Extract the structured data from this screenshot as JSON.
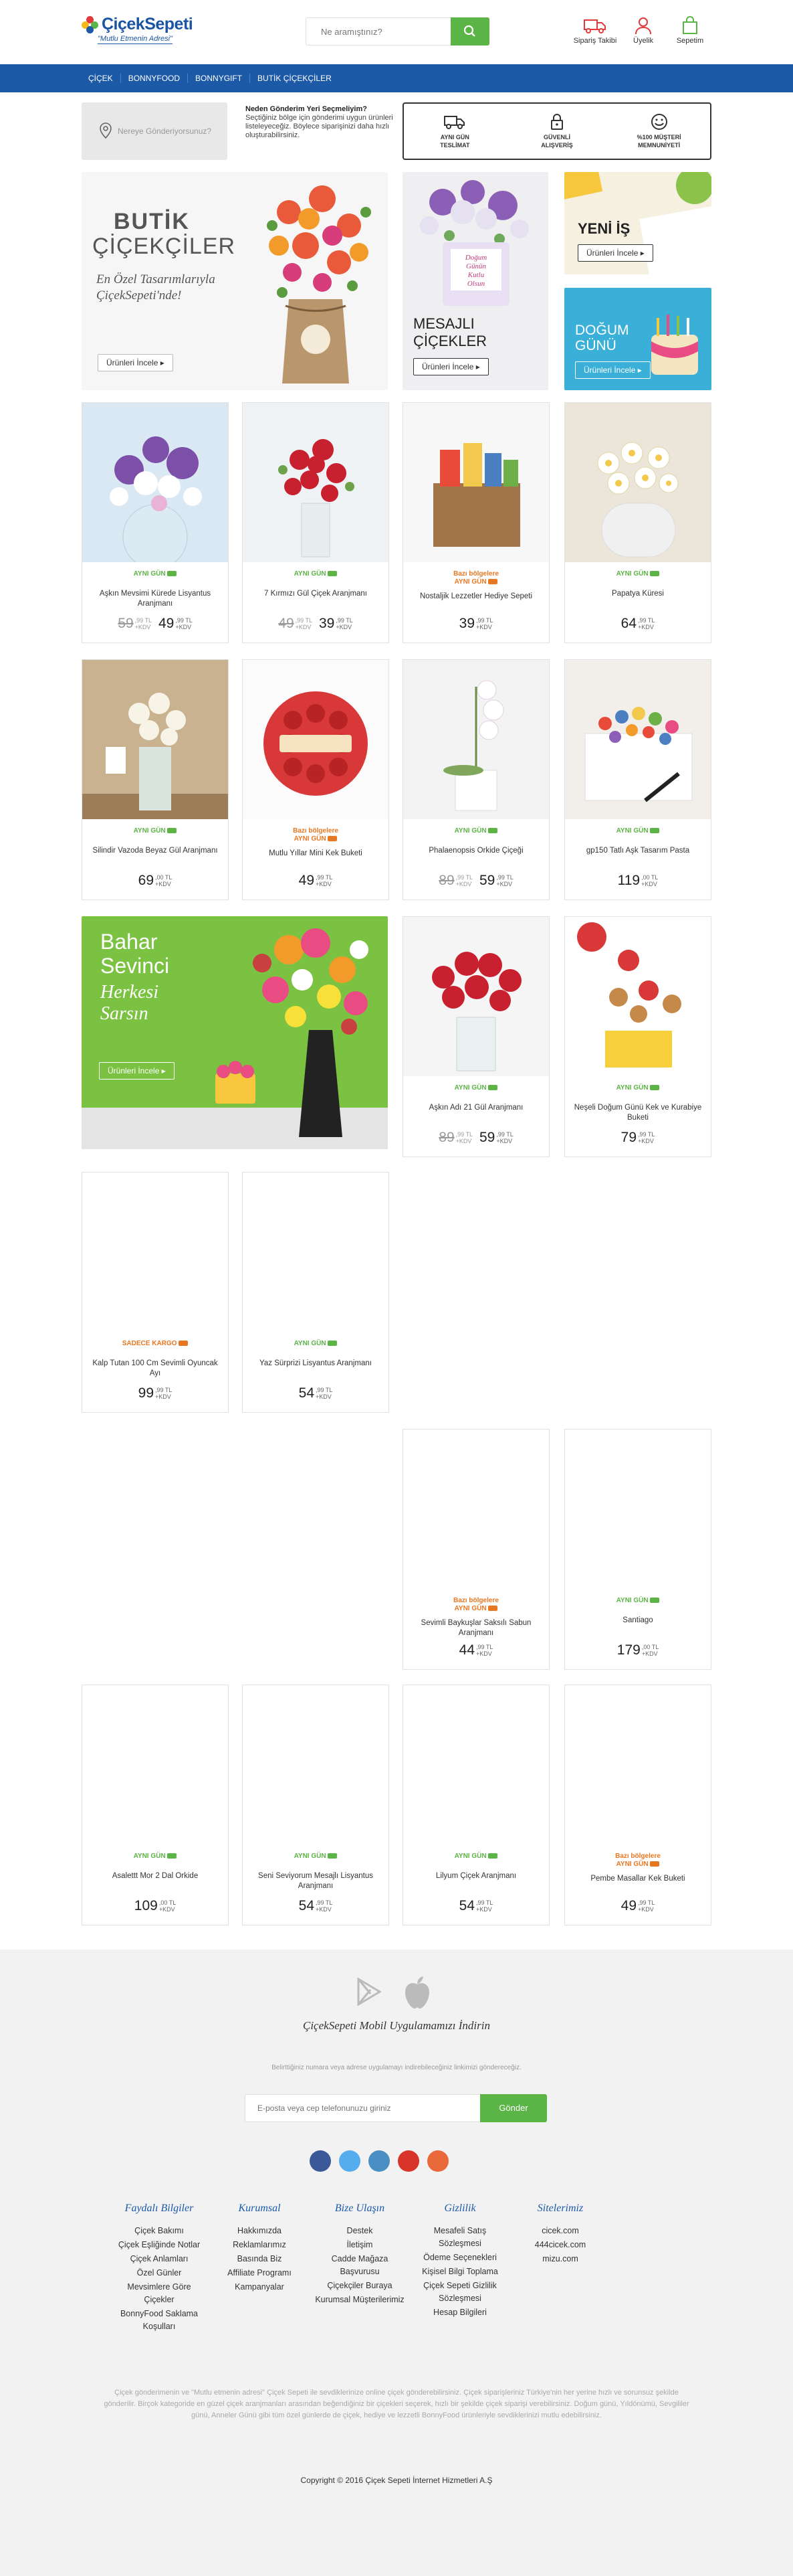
{
  "header": {
    "brand": "ÇiçekSepeti",
    "tagline": "\"Mutlu Etmenin Adresi\"",
    "search_placeholder": "Ne aramıştınız?",
    "actions": [
      {
        "label": "Sipariş Takibi",
        "icon": "truck-icon"
      },
      {
        "label": "Üyelik",
        "icon": "user-icon"
      },
      {
        "label": "Sepetim",
        "icon": "bag-icon"
      }
    ]
  },
  "nav": [
    "ÇİÇEK",
    "BONNYFOOD",
    "BONNYGIFT",
    "BUTİK ÇİÇEKÇİLER"
  ],
  "location": {
    "placeholder": "Nereye Gönderiyorsunuz?"
  },
  "why": {
    "title": "Neden Gönderim Yeri Seçmeliyim?",
    "text": "Seçtiğiniz bölge için gönderimi uygun ürünleri listeleyeceğiz. Böylece siparişinizi daha hızlı oluşturabilirsiniz."
  },
  "features": [
    {
      "icon": "truck-icon",
      "l1": "AYNI GÜN",
      "l2": "TESLİMAT"
    },
    {
      "icon": "lock-icon",
      "l1": "GÜVENLİ",
      "l2": "ALIŞVERİŞ"
    },
    {
      "icon": "smile-icon",
      "l1": "%100 MÜŞTERİ",
      "l2": "MEMNUNİYETİ"
    }
  ],
  "banners": {
    "butik": {
      "title1": "BUTİK",
      "title2": "ÇİÇEKÇİLER",
      "sub1": "En Özel Tasarımlarıyla",
      "sub2": "ÇiçekSepeti'nde!",
      "cta": "Ürünleri İncele"
    },
    "mesajli": {
      "title1": "MESAJLI",
      "title2": "ÇİÇEKLER",
      "cta": "Ürünleri İncele",
      "tag1": "Doğum",
      "tag2": "Günün",
      "tag3": "Kutlu",
      "tag4": "Olsun"
    },
    "yenis": {
      "title": "YENİ İŞ",
      "cta": "Ürünleri İncele"
    },
    "dogum": {
      "title1": "DOĞUM",
      "title2": "GÜNÜ",
      "cta": "Ürünleri İncele"
    },
    "bahar": {
      "title1": "Bahar",
      "title2": "Sevinci",
      "sub1": "Herkesi",
      "sub2": "Sarsın",
      "cta": "Ürünleri İncele"
    }
  },
  "products": [
    {
      "badge": "AYNI GÜN",
      "badge2": "",
      "name": "Aşkın Mevsimi Kürede Lisyantus Aranjmanı",
      "old": "59",
      "oldsm": ",99 TL",
      "price": "49",
      "sm": ",99 TL",
      "kdv": "+KDV"
    },
    {
      "badge": "AYNI GÜN",
      "badge2": "",
      "name": "7 Kırmızı Gül Çiçek Aranjmanı",
      "old": "49",
      "oldsm": ",99 TL",
      "price": "39",
      "sm": ",99 TL",
      "kdv": "+KDV"
    },
    {
      "badge": "Bazı bölgelere",
      "badge2": "AYNI GÜN",
      "name": "Nostaljik Lezzetler Hediye Sepeti",
      "old": "",
      "oldsm": "",
      "price": "39",
      "sm": ",99 TL",
      "kdv": "+KDV"
    },
    {
      "badge": "AYNI GÜN",
      "badge2": "",
      "name": "Papatya Küresi",
      "old": "",
      "oldsm": "",
      "price": "64",
      "sm": ",99 TL",
      "kdv": "+KDV"
    },
    {
      "badge": "AYNI GÜN",
      "badge2": "",
      "name": "Silindir Vazoda Beyaz Gül Aranjmanı",
      "old": "",
      "oldsm": "",
      "price": "69",
      "sm": ",00 TL",
      "kdv": "+KDV"
    },
    {
      "badge": "Bazı bölgelere",
      "badge2": "AYNI GÜN",
      "name": "Mutlu Yıllar Mini Kek Buketi",
      "old": "",
      "oldsm": "",
      "price": "49",
      "sm": ",99 TL",
      "kdv": "+KDV"
    },
    {
      "badge": "AYNI GÜN",
      "badge2": "",
      "name": "Phalaenopsis Orkide Çiçeği",
      "old": "89",
      "oldsm": ",99 TL",
      "price": "59",
      "sm": ",99 TL",
      "kdv": "+KDV"
    },
    {
      "badge": "AYNI GÜN",
      "badge2": "",
      "name": "gp150 Tatlı Aşk Tasarım Pasta",
      "old": "",
      "oldsm": "",
      "price": "119",
      "sm": ",00 TL",
      "kdv": "+KDV"
    },
    {
      "badge": "AYNI GÜN",
      "badge2": "",
      "name": "Aşkın Adı 21 Gül Aranjmanı",
      "old": "89",
      "oldsm": ",99 TL",
      "price": "59",
      "sm": ",99 TL",
      "kdv": "+KDV"
    },
    {
      "badge": "AYNI GÜN",
      "badge2": "",
      "name": "Neşeli Doğum Günü Kek ve Kurabiye Buketi",
      "old": "",
      "oldsm": "",
      "price": "79",
      "sm": ",99 TL",
      "kdv": "+KDV"
    },
    {
      "badge": "SADECE KARGO",
      "badge2": "",
      "name": "Kalp Tutan 100 Cm Sevimli Oyuncak Ayı",
      "old": "",
      "oldsm": "",
      "price": "99",
      "sm": ",99 TL",
      "kdv": "+KDV"
    },
    {
      "badge": "AYNI GÜN",
      "badge2": "",
      "name": "Yaz Sürprizi Lisyantus Aranjmanı",
      "old": "",
      "oldsm": "",
      "price": "54",
      "sm": ",99 TL",
      "kdv": "+KDV"
    },
    {
      "badge": "Bazı bölgelere",
      "badge2": "AYNI GÜN",
      "name": "Sevimli Baykuşlar Saksılı Sabun Aranjmanı",
      "old": "",
      "oldsm": "",
      "price": "44",
      "sm": ",99 TL",
      "kdv": "+KDV"
    },
    {
      "badge": "AYNI GÜN",
      "badge2": "",
      "name": "Santiago",
      "old": "",
      "oldsm": "",
      "price": "179",
      "sm": ",00 TL",
      "kdv": "+KDV"
    },
    {
      "badge": "AYNI GÜN",
      "badge2": "",
      "name": "Asalettt Mor 2 Dal Orkide",
      "old": "",
      "oldsm": "",
      "price": "109",
      "sm": ",00 TL",
      "kdv": "+KDV"
    },
    {
      "badge": "AYNI GÜN",
      "badge2": "",
      "name": "Seni Seviyorum Mesajlı Lisyantus Aranjmanı",
      "old": "",
      "oldsm": "",
      "price": "54",
      "sm": ",99 TL",
      "kdv": "+KDV"
    },
    {
      "badge": "AYNI GÜN",
      "badge2": "",
      "name": "Lilyum Çiçek Aranjmanı",
      "old": "",
      "oldsm": "",
      "price": "54",
      "sm": ",99 TL",
      "kdv": "+KDV"
    },
    {
      "badge": "Bazı bölgelere",
      "badge2": "AYNI GÜN",
      "name": "Pembe Masallar Kek Buketi",
      "old": "",
      "oldsm": "",
      "price": "49",
      "sm": ",99 TL",
      "kdv": "+KDV"
    }
  ],
  "footer": {
    "app_title": "ÇiçekSepeti Mobil Uygulamamızı İndirin",
    "sms_text": "Belirttiğiniz numara veya adrese uygulamayı indirebileceğiniz linkimizi göndereceğiz.",
    "phone_placeholder": "E-posta veya cep telefonunuzu giriniz",
    "send": "Gönder",
    "columns": [
      {
        "title": "Faydalı Bilgiler",
        "items": [
          "Çiçek Bakımı",
          "Çiçek Eşliğinde Notlar",
          "Çiçek Anlamları",
          "Özel Günler",
          "Mevsimlere Göre Çiçekler",
          "BonnyFood Saklama Koşulları"
        ]
      },
      {
        "title": "Kurumsal",
        "items": [
          "Hakkımızda",
          "Reklamlarımız",
          "Basında Biz",
          "Affiliate Programı",
          "Kampanyalar"
        ]
      },
      {
        "title": "Bize Ulaşın",
        "items": [
          "Destek",
          "İletişim",
          "Cadde Mağaza Başvurusu",
          "Çiçekçiler Buraya",
          "Kurumsal Müşterilerimiz"
        ]
      },
      {
        "title": "Gizlilik",
        "items": [
          "Mesafeli Satış Sözleşmesi",
          "Ödeme Seçenekleri",
          "Kişisel Bilgi Toplama",
          "Çiçek Sepeti Gizlilik Sözleşmesi",
          "Hesap Bilgileri"
        ]
      },
      {
        "title": "Sitelerimiz",
        "items": [
          "cicek.com",
          "444cicek.com",
          "mizu.com"
        ]
      }
    ],
    "about": "Çiçek gönderimenin ve \"Mutlu etmenin adresi\" Çiçek Sepeti ile sevdiklerinize online çiçek gönderebilirsiniz. Çiçek siparişleriniz Türkiye'nin her yerine hızlı ve sorunsuz şekilde gönderilir. Birçok kategoride en güzel çiçek aranjmanları arasından beğendiğiniz bir çiçekleri seçerek, hızlı bir şekilde çiçek siparişi verebilirsiniz. Doğum günü, Yıldönümü, Sevgililer günü, Anneler Günü gibi tüm özel günlerde de çiçek, hediye ve lezzetli BonnyFood ürünleriyle sevdiklerinizi mutlu edebilirsiniz.",
    "copyright": "Copyright © 2016 Çiçek Sepeti İnternet Hizmetleri A.Ş"
  },
  "colors": {
    "brand_blue": "#1c59a7",
    "green": "#5bb446",
    "orange": "#e87722",
    "red_icon": "#e2393b"
  }
}
